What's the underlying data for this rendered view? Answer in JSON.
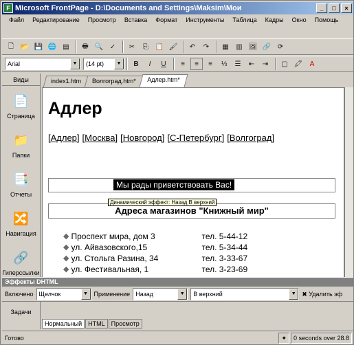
{
  "window": {
    "title": "Microsoft FrontPage - D:\\Documents and Settings\\Maksim\\Мои",
    "min": "_",
    "max": "□",
    "close": "×"
  },
  "menu": [
    "Файл",
    "Редактирование",
    "Просмотр",
    "Вставка",
    "Формат",
    "Инструменты",
    "Таблица",
    "Кадры",
    "Окно",
    "Помощь"
  ],
  "toolbar2": {
    "font": "Arial",
    "size": "(14 pt)",
    "bold": "B",
    "italic": "I",
    "underline": "U"
  },
  "views": {
    "title": "Виды",
    "items": [
      {
        "label": "Страница",
        "icon": "📄"
      },
      {
        "label": "Папки",
        "icon": "📁"
      },
      {
        "label": "Отчеты",
        "icon": "📑"
      },
      {
        "label": "Навигация",
        "icon": "🔀"
      },
      {
        "label": "Гиперссылки",
        "icon": "🔗"
      },
      {
        "label": "Задачи",
        "icon": "✔"
      }
    ]
  },
  "tabs": [
    "index1.htm",
    "Волгоград.htm*",
    "Адлер.htm*"
  ],
  "page": {
    "heading": "Адлер",
    "links": [
      "[Адлер]",
      "[Москва]",
      "[Новгород]",
      "[С-Петербург]",
      "[Волгоград]"
    ],
    "welcome": "Мы рады приветствовать Вас!",
    "tooltip": "Динамический эффект: Назад В верхний",
    "stores_heading": "Адреса магазинов \"Книжный мир\"",
    "stores": [
      {
        "addr": "Проспект мира, дом 3",
        "tel": "тел. 5-44-12"
      },
      {
        "addr": "ул. Айвазовского,15",
        "tel": "тел. 5-34-44"
      },
      {
        "addr": "ул. Стольга Разина, 34",
        "tel": "тел. 3-33-67"
      },
      {
        "addr": "ул. Фестивальная, 1",
        "tel": "тел. 3-23-69"
      }
    ]
  },
  "dhtml": {
    "title": "Эффекты DHTML",
    "on_label": "Включено",
    "on_value": "Щелчок",
    "apply_label": "Применение",
    "apply_value": "Назад",
    "dir_value": "В верхний",
    "remove_label": "Удалить эф"
  },
  "viewtabs": [
    "Нормальный",
    "HTML",
    "Просмотр"
  ],
  "status": {
    "text": "Готово",
    "timing": "0 seconds over 28.8"
  }
}
